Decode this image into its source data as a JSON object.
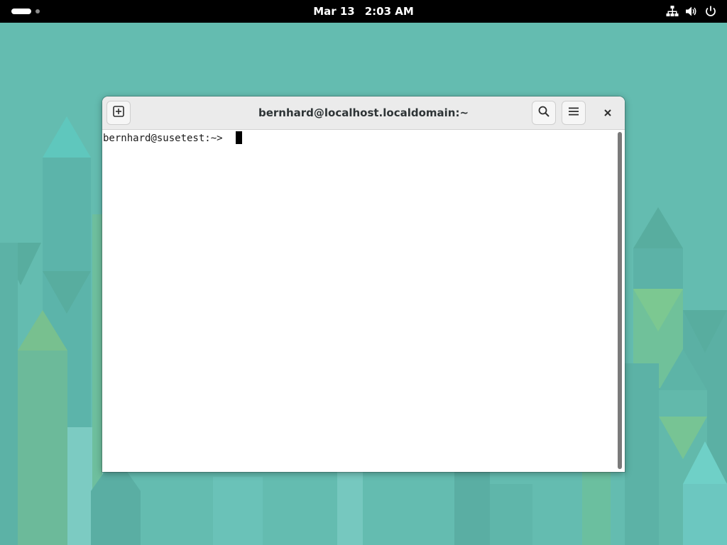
{
  "topbar": {
    "date": "Mar 13",
    "time": "2:03 AM",
    "tray_icons": [
      "network-icon",
      "volume-icon",
      "power-icon"
    ]
  },
  "window": {
    "title": "bernhard@localhost.localdomain:~",
    "buttons": {
      "new_tab_icon": "new-tab-icon",
      "search_icon": "search-icon",
      "menu_icon": "hamburger-menu-icon",
      "close_icon": "close-icon"
    },
    "terminal": {
      "prompt": "bernhard@susetest:~> "
    }
  },
  "colors": {
    "desktop_background": "#64bcb0",
    "topbar": "#000000",
    "headerbar": "#ebebeb"
  }
}
